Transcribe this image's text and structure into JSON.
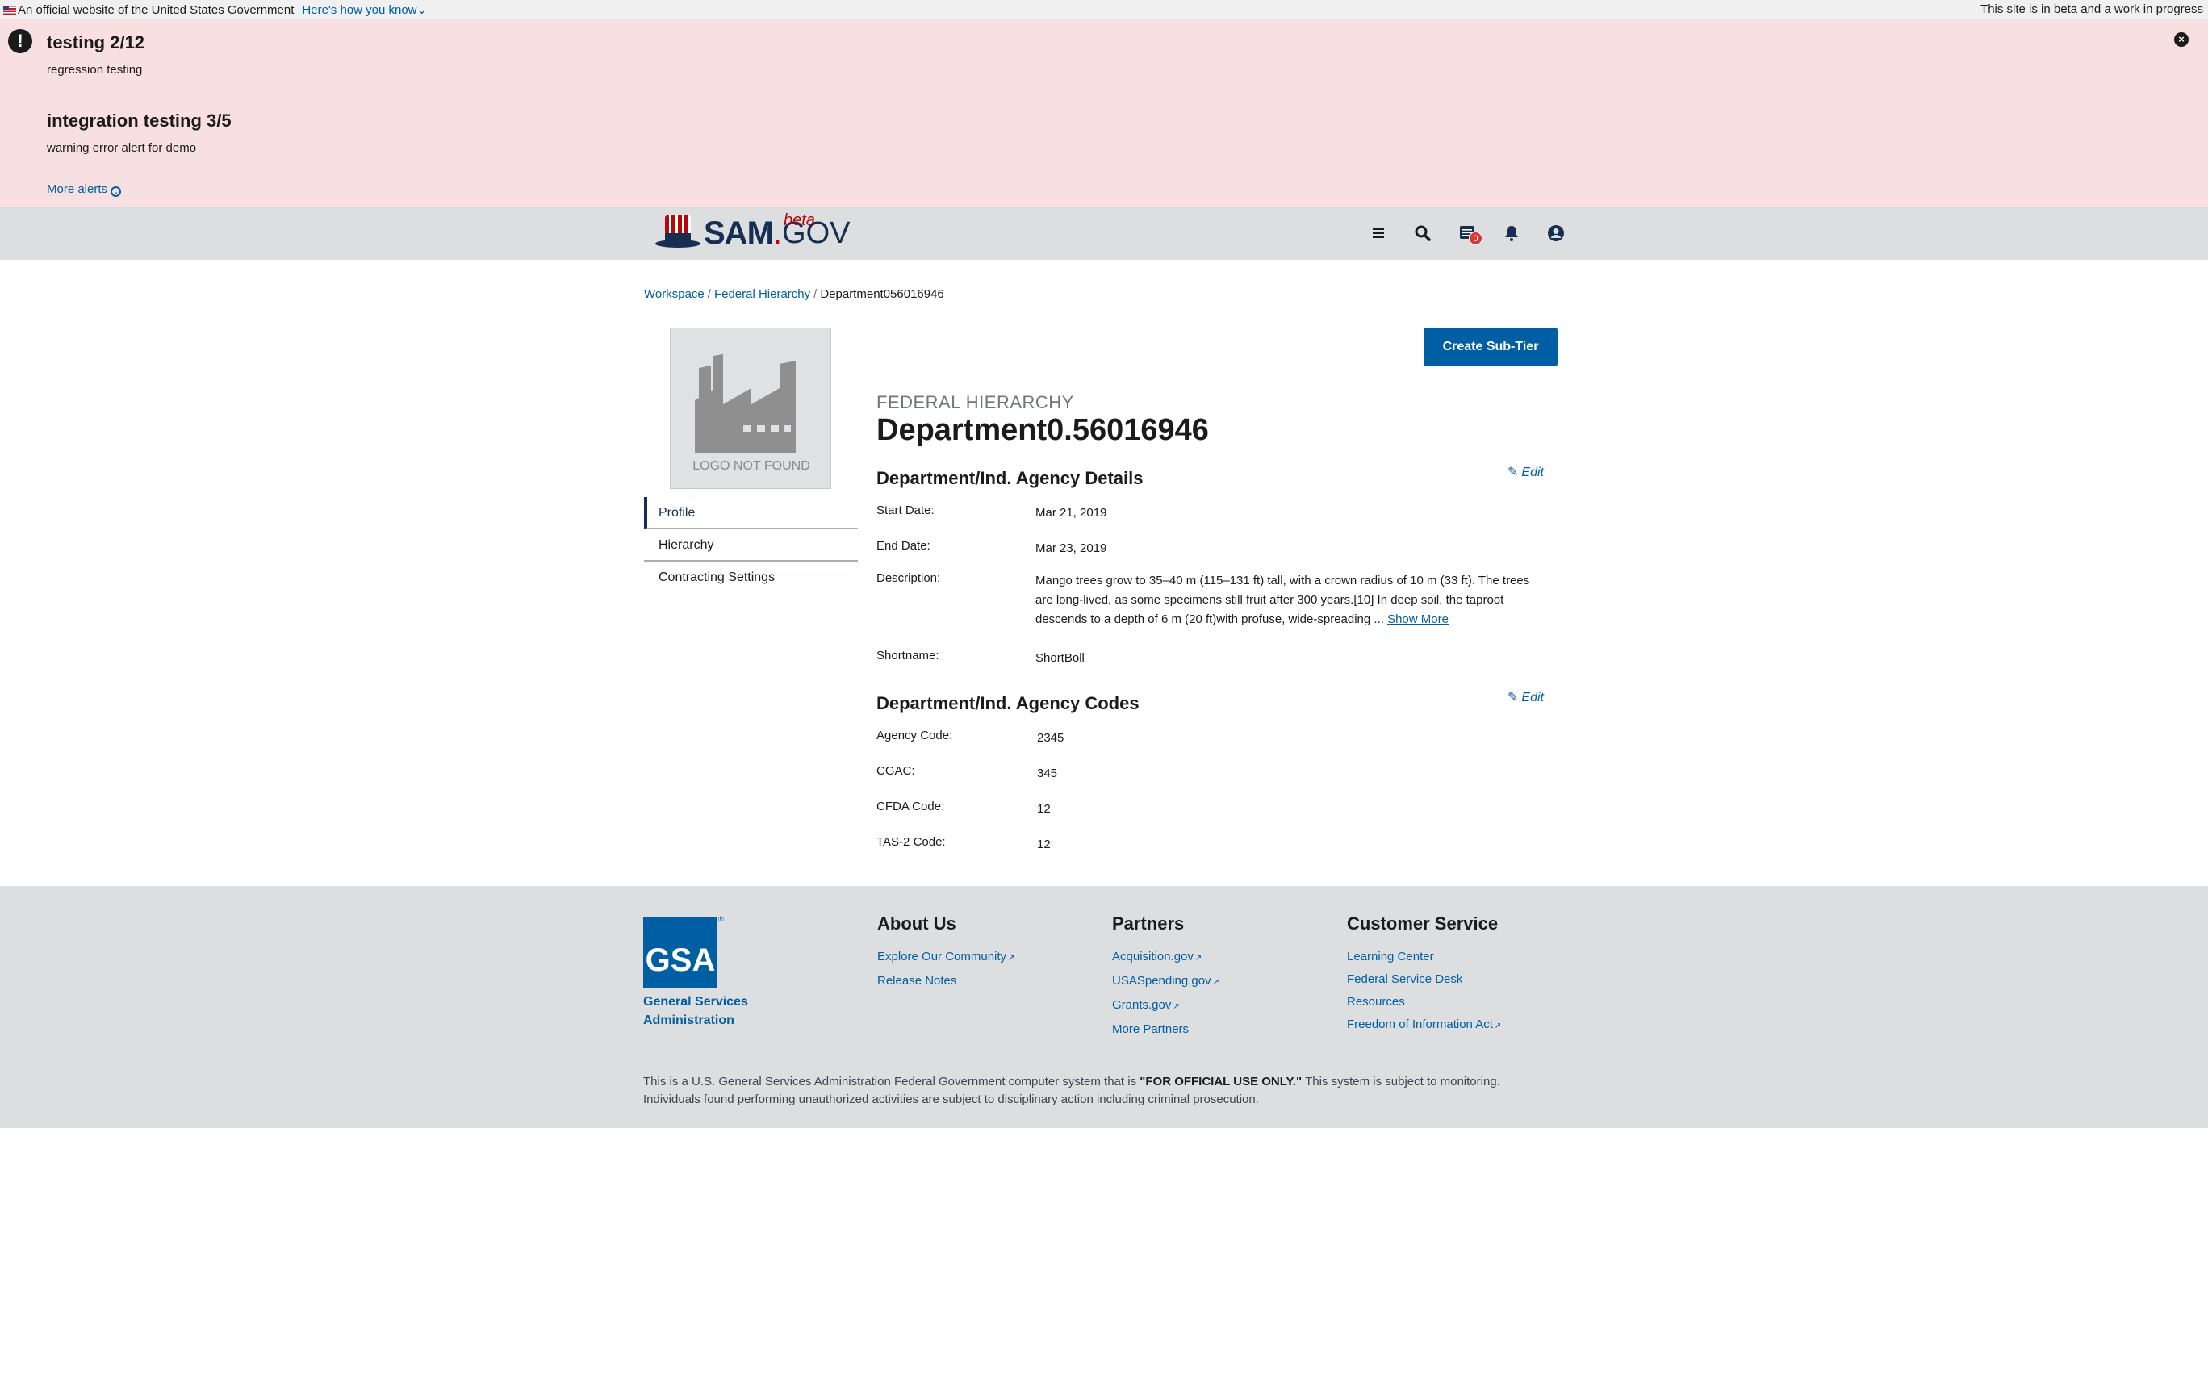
{
  "gov_banner": {
    "official_text": "An official website of the United States Government",
    "how_link": "Here's how you know",
    "beta_text": "This site is in beta and a work in progress"
  },
  "alerts": [
    {
      "title": "testing 2/12",
      "body": "regression testing"
    },
    {
      "title": "integration testing 3/5",
      "body": "warning error alert for demo"
    }
  ],
  "more_alerts": "More alerts",
  "header": {
    "logo_sam": "SAM",
    "logo_dot": ".",
    "logo_gov": "GOV",
    "logo_beta": "beta",
    "notification_count": "0"
  },
  "breadcrumb": {
    "items": [
      "Workspace",
      "Federal Hierarchy"
    ],
    "current": "Department056016946"
  },
  "logo_placeholder": "LOGO NOT FOUND",
  "side_nav": [
    "Profile",
    "Hierarchy",
    "Contracting Settings"
  ],
  "create_button": "Create Sub-Tier",
  "eyebrow": "FEDERAL HIERARCHY",
  "title": "Department0.56016946",
  "details": {
    "heading": "Department/Ind. Agency Details",
    "edit": "Edit",
    "start_date_label": "Start Date:",
    "start_date": "Mar 21, 2019",
    "end_date_label": "End Date:",
    "end_date": "Mar 23, 2019",
    "description_label": "Description:",
    "description": "Mango trees grow to 35–40 m (115–131 ft) tall, with a crown radius of 10 m (33 ft). The trees are long-lived, as some specimens still fruit after 300 years.[10] In deep soil, the taproot descends to a depth of 6 m (20 ft)with profuse, wide-spreading ...",
    "show_more": "Show More",
    "shortname_label": "Shortname:",
    "shortname": "ShortBoll"
  },
  "codes": {
    "heading": "Department/Ind. Agency Codes",
    "edit": "Edit",
    "agency_code_label": "Agency Code:",
    "agency_code": "2345",
    "cgac_label": "CGAC:",
    "cgac": "345",
    "cfda_label": "CFDA Code:",
    "cfda": "12",
    "tas_label": "TAS-2 Code:",
    "tas": "12"
  },
  "footer": {
    "gsa_logo": "GSA",
    "gsa_reg": "®",
    "gsa_name_1": "General Services",
    "gsa_name_2": "Administration",
    "about": {
      "heading": "About Us",
      "links": [
        "Explore Our Community",
        "Release Notes"
      ]
    },
    "partners": {
      "heading": "Partners",
      "links": [
        "Acquisition.gov",
        "USASpending.gov",
        "Grants.gov",
        "More Partners"
      ]
    },
    "service": {
      "heading": "Customer Service",
      "links": [
        "Learning Center",
        "Federal Service Desk",
        "Resources",
        "Freedom of Information Act"
      ]
    },
    "disclaimer_pre": "This is a U.S. General Services Administration Federal Government computer system that is",
    "disclaimer_bold": "\"FOR OFFICIAL USE ONLY.\"",
    "disclaimer_post": "This system is subject to monitoring. Individuals found performing unauthorized activities are subject to disciplinary action including criminal prosecution."
  }
}
